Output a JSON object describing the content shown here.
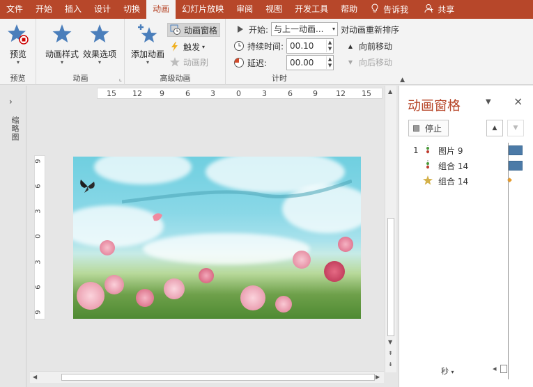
{
  "tabs": [
    "文件",
    "开始",
    "插入",
    "设计",
    "切换",
    "动画",
    "幻灯片放映",
    "审阅",
    "视图",
    "开发工具",
    "帮助"
  ],
  "active_tab": "动画",
  "tell_me": "告诉我",
  "share": "共享",
  "ribbon": {
    "preview": {
      "button": "预览",
      "group": "预览"
    },
    "animation": {
      "style": "动画样式",
      "effect": "效果选项",
      "group": "动画"
    },
    "advanced": {
      "add": "添加动画",
      "pane": "动画窗格",
      "trigger": "触发",
      "painter": "动画刷",
      "group": "高级动画"
    },
    "timing": {
      "start_label": "开始:",
      "start_value": "与上一动画...",
      "duration_label": "持续时间:",
      "duration_value": "00.10",
      "delay_label": "延迟:",
      "delay_value": "00.00",
      "reorder": "对动画重新排序",
      "earlier": "向前移动",
      "later": "向后移动",
      "group": "计时"
    }
  },
  "left_rail_label": "缩略图",
  "hruler": [
    "15",
    "12",
    "9",
    "6",
    "3",
    "0",
    "3",
    "6",
    "9",
    "12",
    "15"
  ],
  "vruler": [
    "9",
    "6",
    "3",
    "0",
    "3",
    "6",
    "9"
  ],
  "pane": {
    "title": "动画窗格",
    "stop": "停止",
    "items": [
      {
        "num": "1",
        "label": "图片 9",
        "icon": "trigger-icon"
      },
      {
        "num": "",
        "label": "组合 14",
        "icon": "trigger-icon"
      },
      {
        "num": "",
        "label": "组合 14",
        "icon": "star-icon"
      }
    ],
    "seconds": "秒"
  },
  "colors": {
    "accent": "#b7472a",
    "bar": "#4b7aa7",
    "star": "#4a7ebb"
  }
}
